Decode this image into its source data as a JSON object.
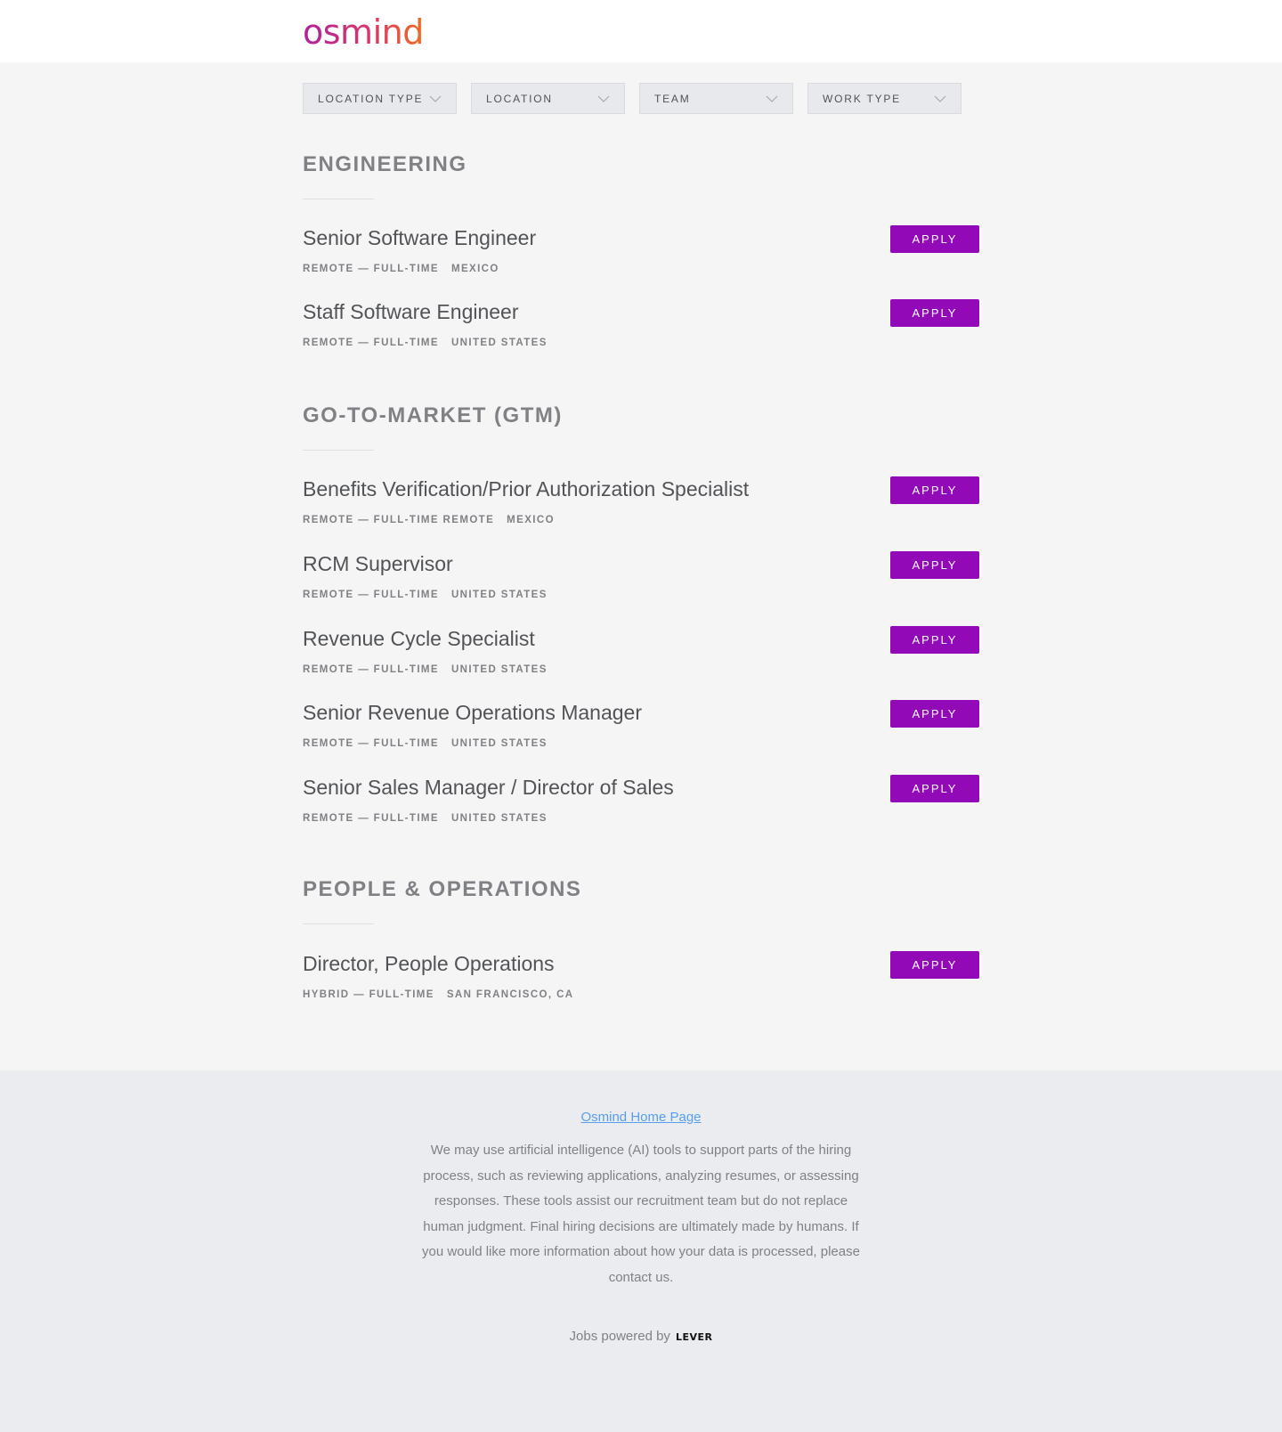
{
  "header": {
    "logo_text": "osmind"
  },
  "filters": [
    {
      "label": "LOCATION TYPE"
    },
    {
      "label": "LOCATION"
    },
    {
      "label": "TEAM"
    },
    {
      "label": "WORK TYPE"
    }
  ],
  "sections": [
    {
      "title": "ENGINEERING",
      "postings": [
        {
          "title": "Senior Software Engineer",
          "commitment": "REMOTE — FULL-TIME",
          "location": "MEXICO",
          "apply": "APPLY"
        },
        {
          "title": "Staff Software Engineer",
          "commitment": "REMOTE — FULL-TIME",
          "location": "UNITED STATES",
          "apply": "APPLY"
        }
      ]
    },
    {
      "title": "GO-TO-MARKET (GTM)",
      "postings": [
        {
          "title": "Benefits Verification/Prior Authorization Specialist",
          "commitment": "REMOTE — FULL-TIME REMOTE",
          "location": "MEXICO",
          "apply": "APPLY"
        },
        {
          "title": "RCM Supervisor",
          "commitment": "REMOTE — FULL-TIME",
          "location": "UNITED STATES",
          "apply": "APPLY"
        },
        {
          "title": "Revenue Cycle Specialist",
          "commitment": "REMOTE — FULL-TIME",
          "location": "UNITED STATES",
          "apply": "APPLY"
        },
        {
          "title": "Senior Revenue Operations Manager",
          "commitment": "REMOTE — FULL-TIME",
          "location": "UNITED STATES",
          "apply": "APPLY"
        },
        {
          "title": "Senior Sales Manager / Director of Sales",
          "commitment": "REMOTE — FULL-TIME",
          "location": "UNITED STATES",
          "apply": "APPLY"
        }
      ]
    },
    {
      "title": "PEOPLE & OPERATIONS",
      "postings": [
        {
          "title": "Director, People Operations",
          "commitment": "HYBRID — FULL-TIME",
          "location": "SAN FRANCISCO, CA",
          "apply": "APPLY"
        }
      ]
    }
  ],
  "footer": {
    "home_link": "Osmind Home Page",
    "ai_notice": "We may use artificial intelligence (AI) tools to support parts of the hiring process, such as reviewing applications, analyzing resumes, or assessing responses. These tools assist our recruitment team but do not replace human judgment. Final hiring decisions are ultimately made by humans. If you would like more information about how your data is processed, please contact us.",
    "powered_by": "Jobs powered by",
    "powered_brand": "LEVER"
  },
  "colors": {
    "accent": "#9209b8",
    "background": "#f5f5f6",
    "footer_background": "#ebecef",
    "link": "#579eee"
  },
  "icons": {
    "filter_dropdown": "chevron-down-icon"
  }
}
